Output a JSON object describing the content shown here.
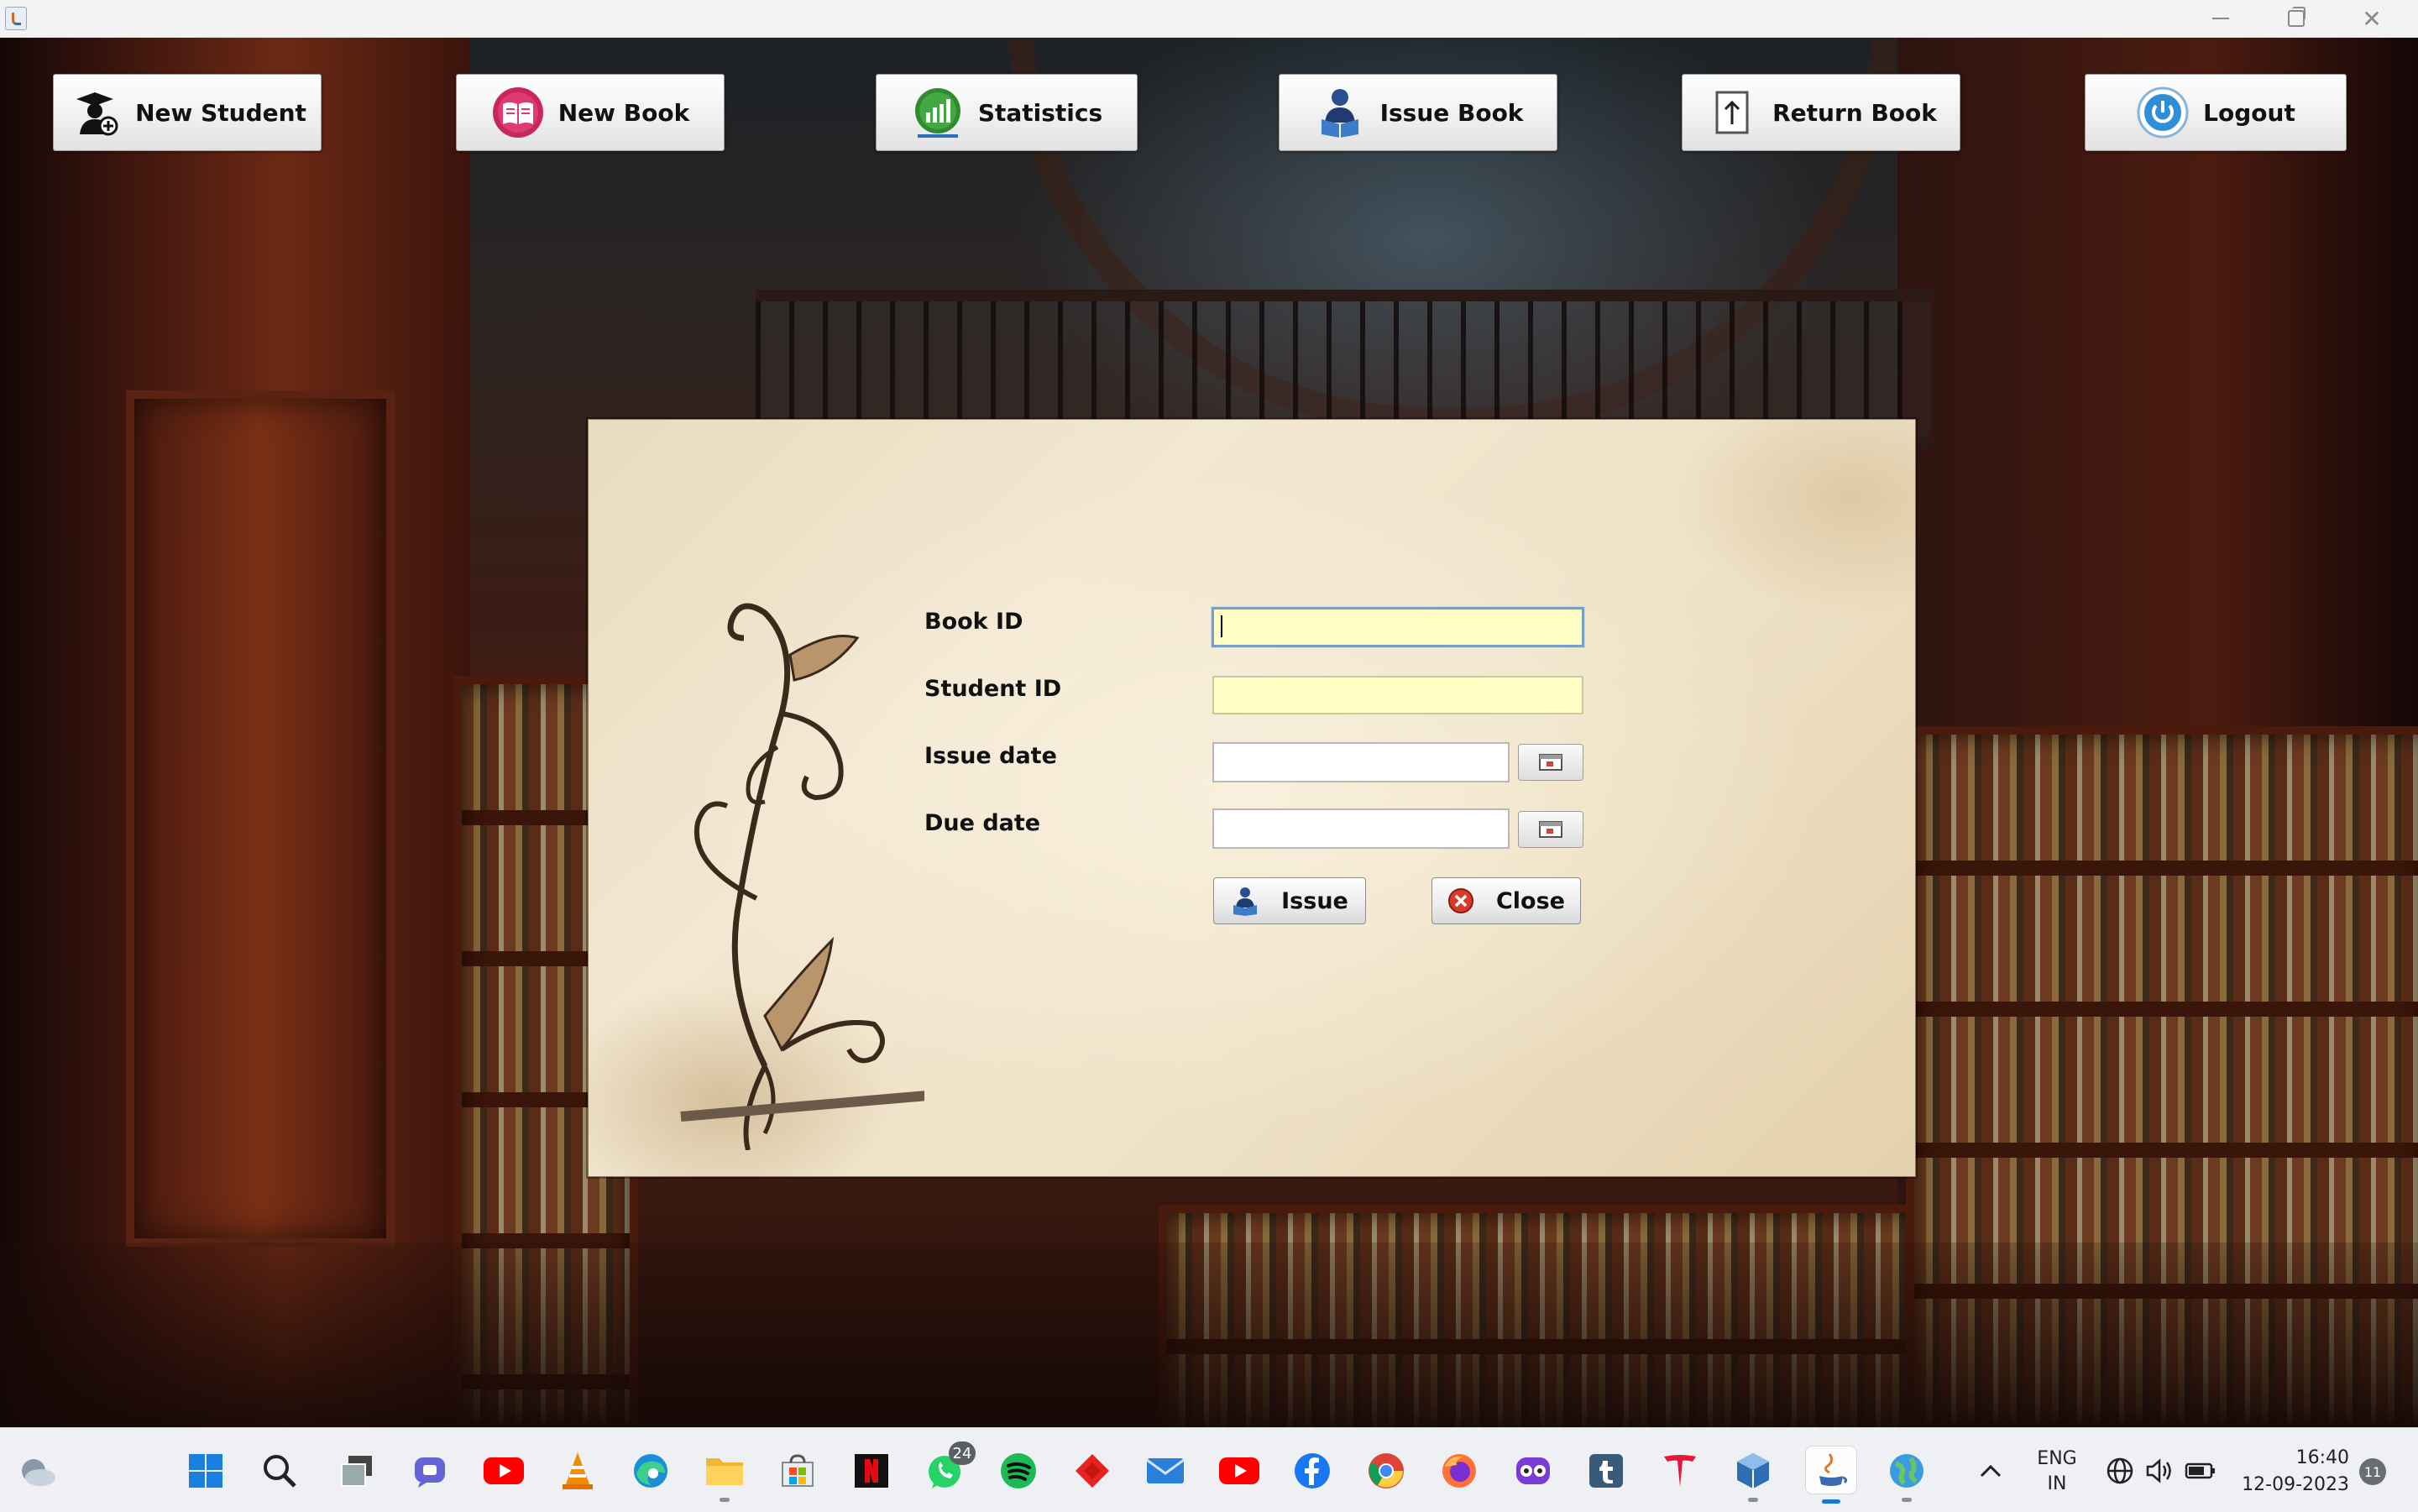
{
  "window": {
    "minimize_glyph": "—",
    "close_glyph": "✕"
  },
  "toolbar": {
    "new_student": "New Student",
    "new_book": "New Book",
    "statistics": "Statistics",
    "issue_book": "Issue Book",
    "return_book": "Return Book",
    "logout": "Logout"
  },
  "form": {
    "book_id_label": "Book ID",
    "student_id_label": "Student ID",
    "issue_date_label": "Issue date",
    "due_date_label": "Due date",
    "book_id_value": "",
    "student_id_value": "",
    "issue_date_value": "",
    "due_date_value": "",
    "issue_button": "Issue",
    "close_button": "Close"
  },
  "taskbar": {
    "whatsapp_badge": "24",
    "lang_line1": "ENG",
    "lang_line2": "IN",
    "time": "16:40",
    "date": "12-09-2023",
    "notification_count": "11"
  },
  "colors": {
    "required_field_bg": "#ffffc4",
    "focus_border": "#7a9fc6",
    "close_icon_red": "#d93a2b"
  }
}
